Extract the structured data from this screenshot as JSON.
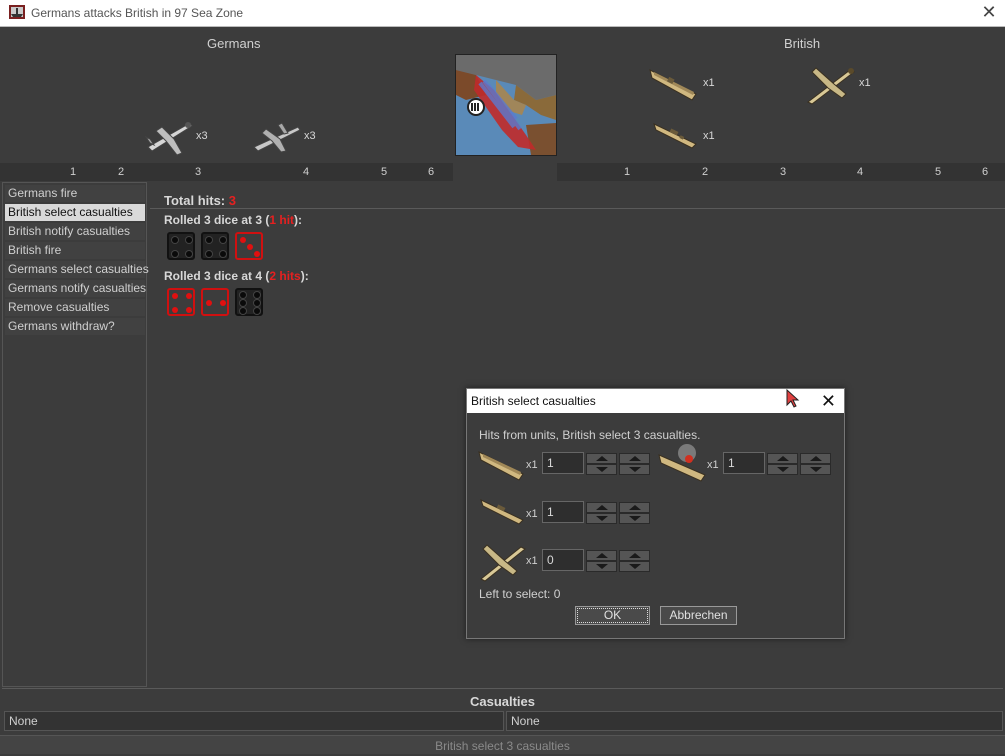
{
  "window": {
    "title": "Germans attacks British in 97 Sea Zone",
    "close_glyph": "✕"
  },
  "germans": {
    "name": "Germans",
    "units": [
      {
        "icon": "fighter-plane-icon",
        "count": "x3"
      },
      {
        "icon": "bomber-plane-icon",
        "count": "x3"
      }
    ]
  },
  "british": {
    "name": "British",
    "units": [
      {
        "icon": "carrier-ship-icon",
        "count": "x1"
      },
      {
        "icon": "fighter-plane-icon",
        "count": "x1"
      },
      {
        "icon": "destroyer-ship-icon",
        "count": "x1"
      }
    ]
  },
  "column_numbers": [
    "1",
    "2",
    "3",
    "4",
    "5",
    "6"
  ],
  "steps": [
    "Germans fire",
    "British select casualties",
    "British notify casualties",
    "British fire",
    "Germans select casualties",
    "Germans notify casualties",
    "Remove casualties",
    "Germans withdraw?"
  ],
  "selected_step": "British select casualties",
  "battle": {
    "total_hits_label": "Total hits:",
    "total_hits_value": "3",
    "rolls": [
      {
        "prefix": "Rolled 3 dice at 3 (",
        "hits": "1 hit",
        "suffix": "):",
        "dice": [
          {
            "face": 4,
            "hit": false
          },
          {
            "face": 4,
            "hit": false
          },
          {
            "face": 3,
            "hit": true
          }
        ]
      },
      {
        "prefix": "Rolled 3 dice at 4 (",
        "hits": "2 hits",
        "suffix": "):",
        "dice": [
          {
            "face": 4,
            "hit": true
          },
          {
            "face": 2,
            "hit": true
          },
          {
            "face": 6,
            "hit": false
          }
        ]
      }
    ]
  },
  "dialog": {
    "title": "British select casualties",
    "close_glyph": "✕",
    "message": "Hits from units,  British select 3 casualties.",
    "rows": [
      {
        "icon": "carrier-ship-icon",
        "count": "x1",
        "value": "1"
      },
      {
        "icon": "damaged-battleship-icon",
        "count": "x1",
        "value": "1"
      },
      {
        "icon": "destroyer-ship-icon",
        "count": "x1",
        "value": "1"
      },
      {
        "icon": "fighter-plane-icon",
        "count": "x1",
        "value": "0"
      }
    ],
    "left_to_select": "Left to select: 0",
    "ok_label": "OK",
    "cancel_label": "Abbrechen"
  },
  "casualties": {
    "title": "Casualties",
    "left": "None",
    "right": "None"
  },
  "status_bar": "British select 3 casualties",
  "colors": {
    "hit_red": "#e62020",
    "background": "#3c3c3c",
    "selected_step_bg": "#d9d9d9"
  }
}
